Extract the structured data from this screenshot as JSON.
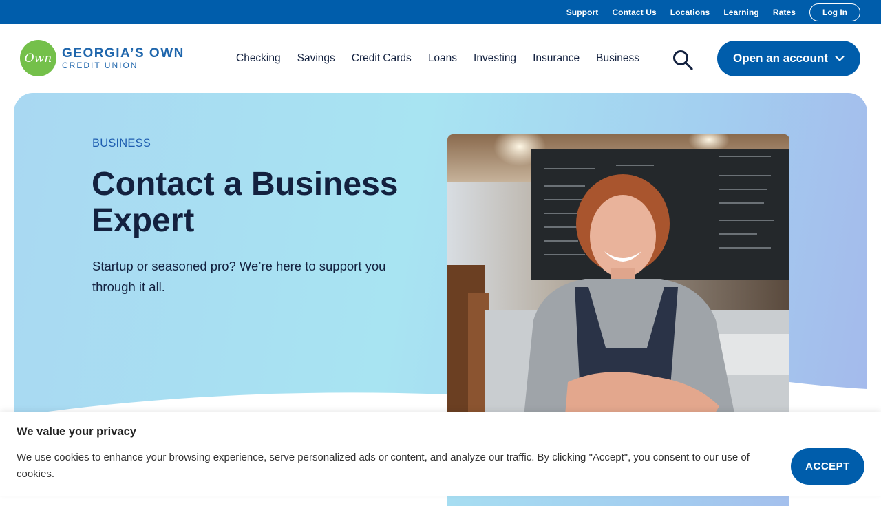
{
  "utility_nav": {
    "links": [
      "Support",
      "Contact Us",
      "Locations",
      "Learning",
      "Rates"
    ],
    "login_label": "Log In"
  },
  "logo": {
    "badge_text": "Own",
    "line1": "GEORGIA’S OWN",
    "line2": "CREDIT UNION"
  },
  "main_nav": {
    "items": [
      "Checking",
      "Savings",
      "Credit Cards",
      "Loans",
      "Investing",
      "Insurance",
      "Business"
    ],
    "search_icon": "search-icon",
    "open_account_label": "Open an account",
    "open_account_icon": "chevron-down-icon"
  },
  "hero": {
    "eyebrow": "BUSINESS",
    "title": "Contact a Business Expert",
    "subtitle": "Startup or seasoned pro? We’re here to support you through it all."
  },
  "cookie_banner": {
    "title": "We value your privacy",
    "text": "We use cookies to enhance your browsing experience, serve personalized ads or content, and analyze our traffic. By clicking \"Accept\", you consent to our use of cookies.",
    "accept_label": "ACCEPT"
  },
  "colors": {
    "brand_blue": "#005dab",
    "brand_green": "#74c04a",
    "text_dark": "#13213f"
  }
}
